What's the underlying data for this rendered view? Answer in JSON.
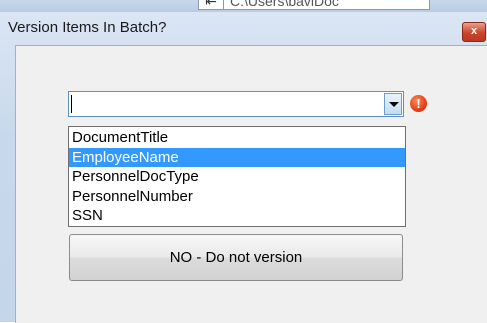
{
  "background_window": {
    "nav_glyph": "⇤",
    "path_text": "C:\\Users\\bavlDoc"
  },
  "dialog": {
    "title": "Version Items In Batch?",
    "close_glyph": "x"
  },
  "combo": {
    "value": "",
    "error_glyph": "!"
  },
  "dropdown": {
    "items": [
      "DocumentTitle",
      "EmployeeName",
      "PersonnelDocType",
      "PersonnelNumber",
      "SSN"
    ],
    "selected_index": 1
  },
  "buttons": {
    "no_label": "NO - Do not version"
  },
  "colors": {
    "selection": "#3399ff",
    "error": "#e2401a",
    "close": "#c9452b"
  }
}
